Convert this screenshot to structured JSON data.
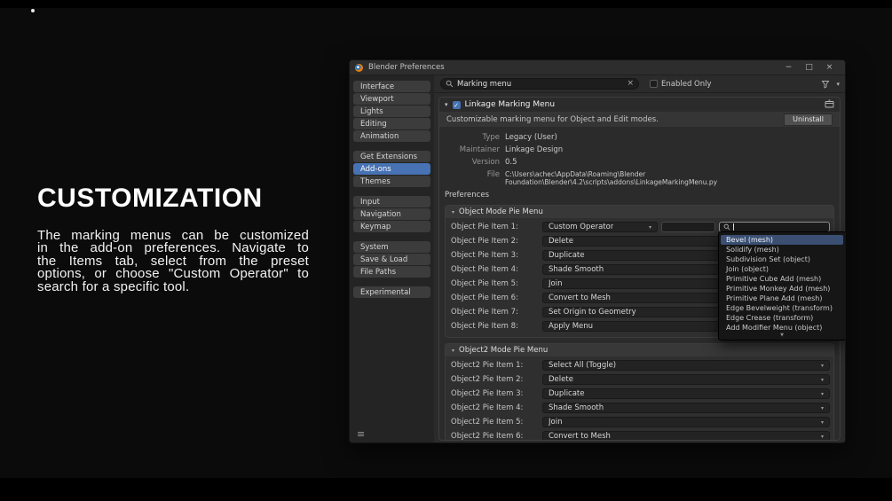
{
  "slide": {
    "heading": "CUSTOMIZATION",
    "paragraph_lines": [
      "The marking menus can be customized",
      "in the add-on preferences. Navigate to",
      "the Items tab, select from the preset",
      "options, or choose \"Custom Operator\" to",
      "search for a specific tool."
    ]
  },
  "icons": {
    "chevron_down": "▾",
    "check": "✓",
    "clear": "×",
    "menu": "≡",
    "more_below": "▼",
    "minimize": "−",
    "maximize": "□",
    "close": "×"
  },
  "colors": {
    "accent_blue": "#4772b3",
    "blender_orange": "#e87d0d"
  },
  "window": {
    "title": "Blender Preferences",
    "sidebar": {
      "items": [
        "Interface",
        "Viewport",
        "Lights",
        "Editing",
        "Animation",
        "Get Extensions",
        "Add-ons",
        "Themes",
        "Input",
        "Navigation",
        "Keymap",
        "System",
        "Save & Load",
        "File Paths",
        "Experimental"
      ],
      "active": "Add-ons"
    },
    "header": {
      "search_value": "Marking menu",
      "enabled_only_label": "Enabled Only"
    },
    "addon": {
      "name": "Linkage Marking Menu",
      "description": "Customizable marking menu for Object and Edit modes.",
      "uninstall_label": "Uninstall",
      "details": [
        {
          "label": "Type",
          "value": "Legacy (User)"
        },
        {
          "label": "Maintainer",
          "value": "Linkage Design"
        },
        {
          "label": "Version",
          "value": "0.5"
        },
        {
          "label": "File",
          "value": "C:\\Users\\achec\\AppData\\Roaming\\Blender Foundation\\Blender\\4.2\\scripts\\addons\\LinkageMarkingMenu.py"
        }
      ],
      "preferences_label": "Preferences"
    },
    "panel_object": {
      "title": "Object Mode Pie Menu",
      "rows": [
        {
          "label": "Object Pie Item 1:",
          "value": "Custom Operator"
        },
        {
          "label": "Object Pie Item 2:",
          "value": "Delete"
        },
        {
          "label": "Object Pie Item 3:",
          "value": "Duplicate"
        },
        {
          "label": "Object Pie Item 4:",
          "value": "Shade Smooth"
        },
        {
          "label": "Object Pie Item 5:",
          "value": "Join"
        },
        {
          "label": "Object Pie Item 6:",
          "value": "Convert to Mesh"
        },
        {
          "label": "Object Pie Item 7:",
          "value": "Set Origin to Geometry"
        },
        {
          "label": "Object Pie Item 8:",
          "value": "Apply Menu"
        }
      ],
      "custom_operator_field": "",
      "search_query": ""
    },
    "operator_search": {
      "results": [
        "Bevel (mesh)",
        "Solidify (mesh)",
        "Subdivision Set (object)",
        "Join (object)",
        "Primitive Cube Add (mesh)",
        "Primitive Monkey Add (mesh)",
        "Primitive Plane Add (mesh)",
        "Edge Bevelweight (transform)",
        "Edge Crease (transform)",
        "Add Modifier Menu (object)"
      ],
      "selected": "Bevel (mesh)"
    },
    "panel_object2": {
      "title": "Object2 Mode Pie Menu",
      "rows": [
        {
          "label": "Object2 Pie Item 1:",
          "value": "Select All (Toggle)"
        },
        {
          "label": "Object2 Pie Item 2:",
          "value": "Delete"
        },
        {
          "label": "Object2 Pie Item 3:",
          "value": "Duplicate"
        },
        {
          "label": "Object2 Pie Item 4:",
          "value": "Shade Smooth"
        },
        {
          "label": "Object2 Pie Item 5:",
          "value": "Join"
        },
        {
          "label": "Object2 Pie Item 6:",
          "value": "Convert to Mesh"
        }
      ]
    }
  }
}
